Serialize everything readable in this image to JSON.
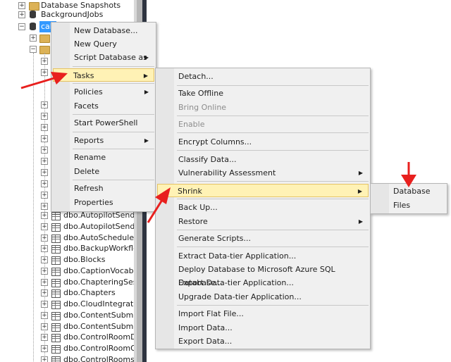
{
  "tree": {
    "database_snapshots": "Database Snapshots",
    "backgroundjobs": "BackgroundJobs",
    "selected_db": "cab",
    "tables": [
      "dbo.AutopilotSendM",
      "dbo.AutopilotSends",
      "dbo.AutoScheduleIns",
      "dbo.BackupWorkflow",
      "dbo.Blocks",
      "dbo.CaptionVocabul",
      "dbo.ChapteringSessio",
      "dbo.Chapters",
      "dbo.CloudIntegration",
      "dbo.ContentSubmiss",
      "dbo.ContentSubmiss",
      "dbo.ControlRoomDe",
      "dbo.ControlRoomOu",
      "dbo.ControlRooms"
    ]
  },
  "context_menu": {
    "new_database": "New Database...",
    "new_query": "New Query",
    "script_database_as": "Script Database as",
    "tasks": "Tasks",
    "policies": "Policies",
    "facets": "Facets",
    "start_powershell": "Start PowerShell",
    "reports": "Reports",
    "rename": "Rename",
    "delete": "Delete",
    "refresh": "Refresh",
    "properties": "Properties"
  },
  "tasks_menu": {
    "detach": "Detach...",
    "take_offline": "Take Offline",
    "bring_online": "Bring Online",
    "enable": "Enable",
    "encrypt_columns": "Encrypt Columns...",
    "classify_data": "Classify Data...",
    "vulnerability_assessment": "Vulnerability Assessment",
    "shrink": "Shrink",
    "back_up": "Back Up...",
    "restore": "Restore",
    "generate_scripts": "Generate Scripts...",
    "extract_data_tier": "Extract Data-tier Application...",
    "deploy_azure": "Deploy Database to Microsoft Azure SQL Database...",
    "export_data_tier": "Export Data-tier Application...",
    "upgrade_data_tier": "Upgrade Data-tier Application...",
    "import_flat_file": "Import Flat File...",
    "import_data": "Import Data...",
    "export_data": "Export Data..."
  },
  "shrink_menu": {
    "database": "Database",
    "files": "Files"
  },
  "colors": {
    "highlight": "#fff2b5",
    "highlight_border": "#e5c365",
    "arrow": "#e8201e",
    "selected_db_bg": "#3399ff"
  },
  "icons": {
    "submenu": "triangle-right",
    "tree_expand": "plus-box",
    "tree_collapse": "minus-box"
  }
}
